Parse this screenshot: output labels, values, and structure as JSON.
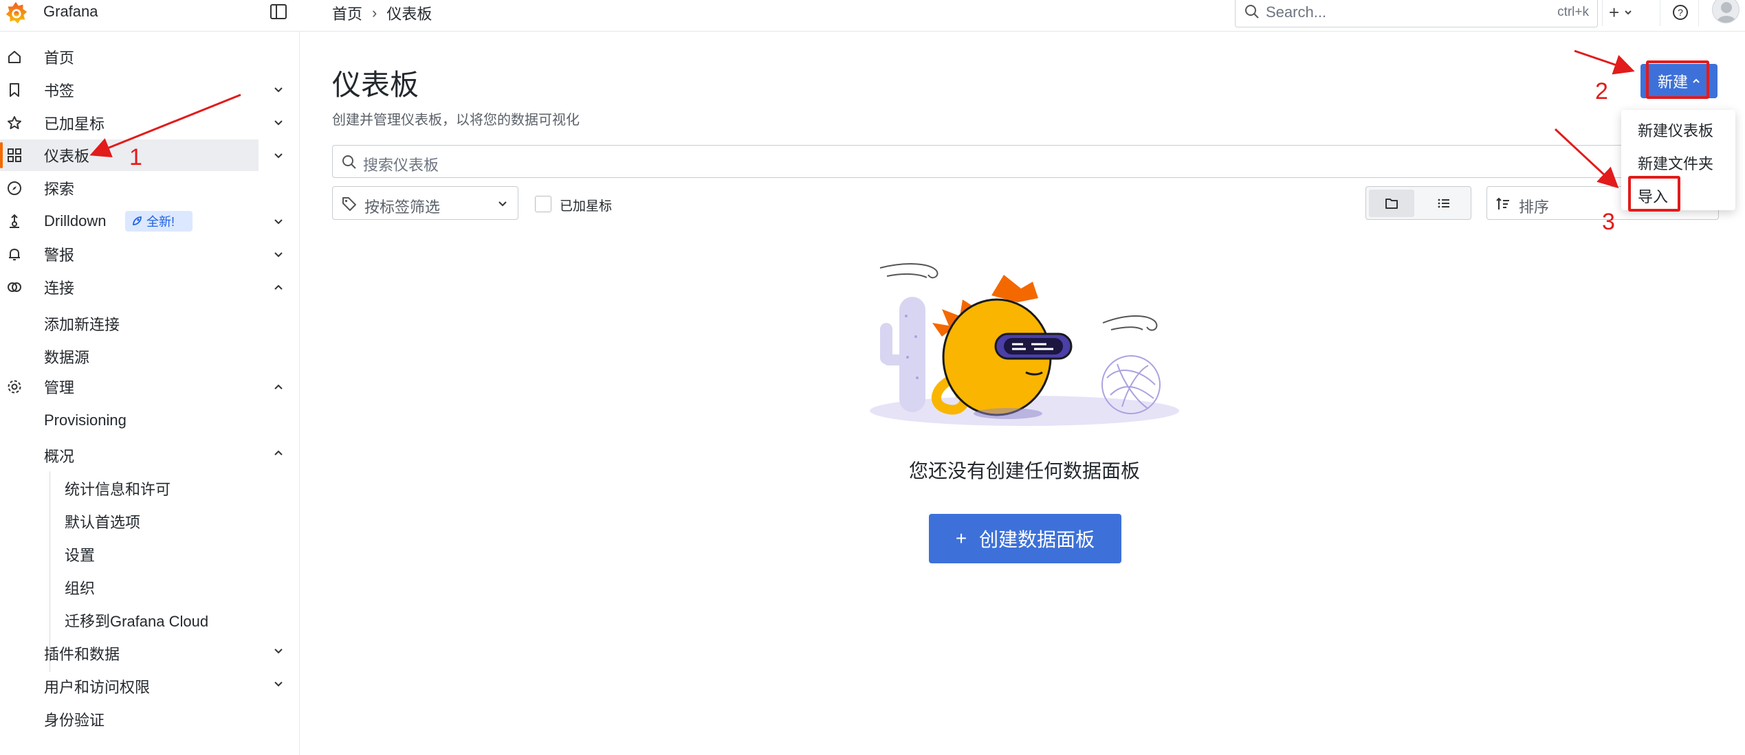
{
  "app": {
    "brand": "Grafana"
  },
  "breadcrumb": {
    "home": "首页",
    "current": "仪表板",
    "separator": "›"
  },
  "topbar": {
    "search_placeholder": "Search...",
    "search_shortcut": "ctrl+k",
    "add_label": "+"
  },
  "sidebar": {
    "items": [
      {
        "label": "首页",
        "icon": "home-icon"
      },
      {
        "label": "书签",
        "icon": "bookmark-icon"
      },
      {
        "label": "已加星标",
        "icon": "star-icon"
      },
      {
        "label": "仪表板",
        "icon": "apps-icon"
      },
      {
        "label": "探索",
        "icon": "compass-icon"
      },
      {
        "label": "Drilldown",
        "icon": "drilldown-icon",
        "badge": "全新!"
      },
      {
        "label": "警报",
        "icon": "bell-icon"
      },
      {
        "label": "连接",
        "icon": "link-icon"
      },
      {
        "label": "管理",
        "icon": "cog-icon"
      }
    ],
    "connections_children": [
      "添加新连接",
      "数据源"
    ],
    "admin_children": [
      "Provisioning",
      "概况"
    ],
    "overview_children": [
      "统计信息和许可",
      "默认首选项",
      "设置",
      "组织",
      "迁移到Grafana Cloud"
    ],
    "admin_more": [
      "插件和数据",
      "用户和访问权限",
      "身份验证"
    ]
  },
  "main": {
    "title": "仪表板",
    "subtitle": "创建并管理仪表板，以将您的数据可视化",
    "search_placeholder": "搜索仪表板",
    "tag_filter_label": "按标签筛选",
    "starred_label": "已加星标",
    "sort_label": "排序",
    "new_button": "新建",
    "new_menu": [
      "新建仪表板",
      "新建文件夹",
      "导入"
    ],
    "empty_title": "您还没有创建任何数据面板",
    "create_button": "创建数据面板",
    "create_button_icon": "+"
  },
  "annotations": {
    "one": "1",
    "two": "2",
    "three": "3"
  },
  "colors": {
    "primary": "#3d71d9",
    "accent": "#f46800",
    "annotation": "#e21b1b"
  }
}
